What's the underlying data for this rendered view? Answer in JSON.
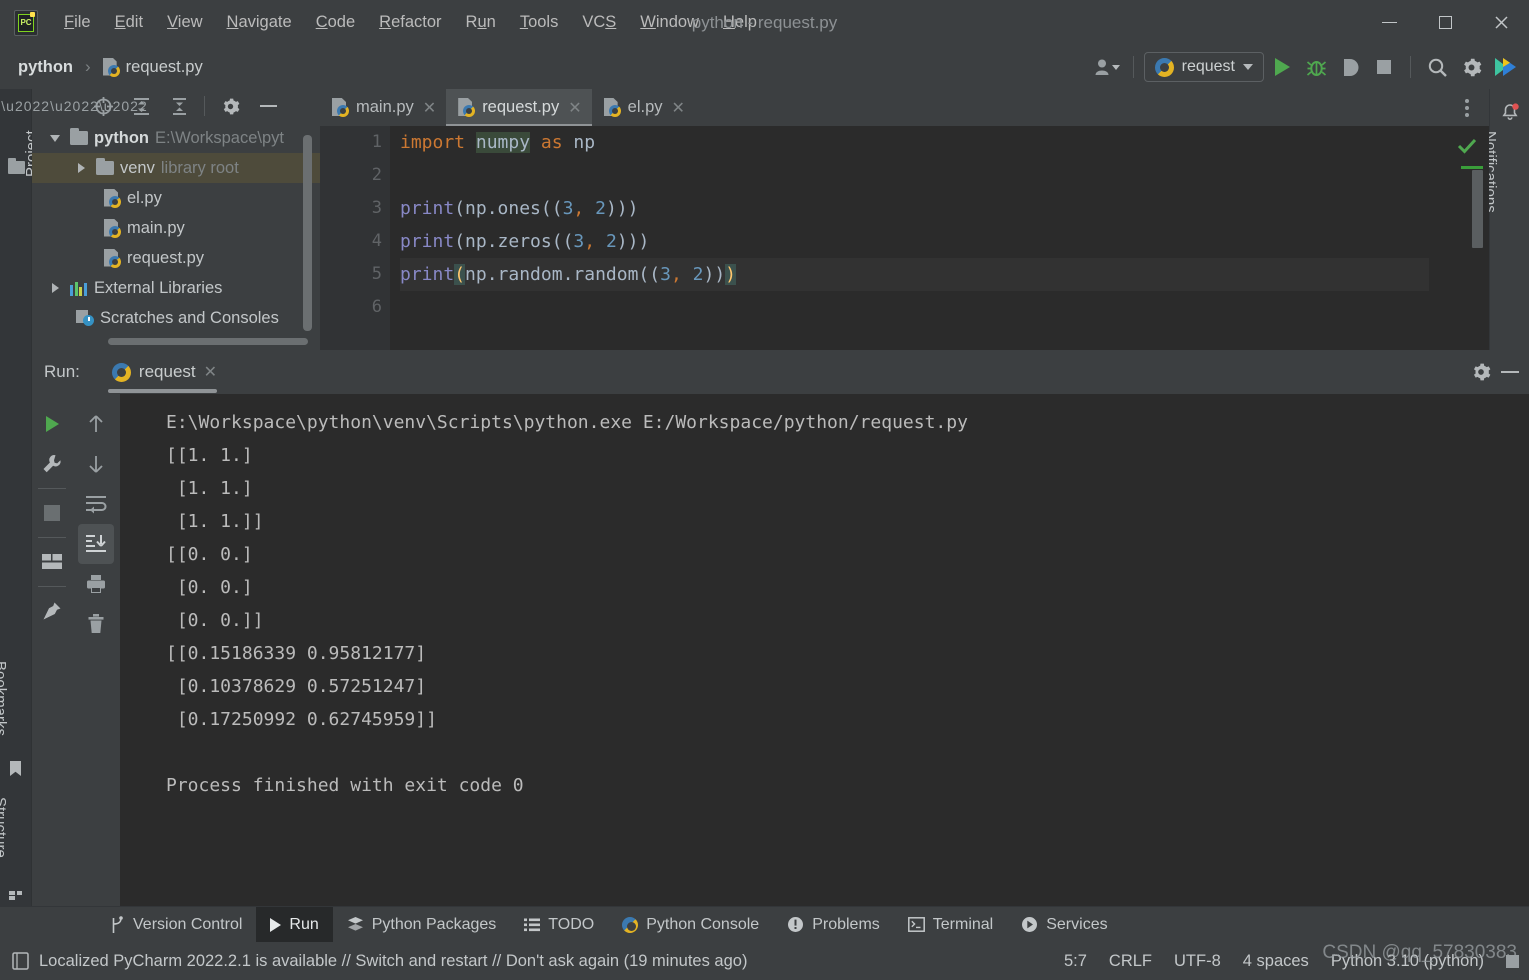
{
  "window": {
    "title": "python - request.py",
    "app_icon": "pycharm-logo-icon",
    "minimize": "—",
    "maximize": "□",
    "close": "✕"
  },
  "menubar": {
    "items": [
      {
        "label": "File",
        "mnemonic": "F"
      },
      {
        "label": "Edit",
        "mnemonic": "E"
      },
      {
        "label": "View",
        "mnemonic": "V"
      },
      {
        "label": "Navigate",
        "mnemonic": "N"
      },
      {
        "label": "Code",
        "mnemonic": "C"
      },
      {
        "label": "Refactor",
        "mnemonic": "R"
      },
      {
        "label": "Run",
        "mnemonic": "u"
      },
      {
        "label": "Tools",
        "mnemonic": "T"
      },
      {
        "label": "VCS",
        "mnemonic": "S"
      },
      {
        "label": "Window",
        "mnemonic": "W"
      },
      {
        "label": "Help",
        "mnemonic": "H"
      }
    ]
  },
  "navbar": {
    "breadcrumb_project": "python",
    "breadcrumb_separator": "›",
    "breadcrumb_file": "request.py",
    "run_config": "request",
    "icons": [
      "user-account-icon",
      "python-interpreter-icon",
      "run-icon",
      "debug-icon",
      "run-coverage-icon",
      "stop-icon",
      "search-everywhere-icon",
      "settings-gear-icon",
      "pycharm-brand-icon"
    ]
  },
  "left_toolbar": {
    "items": [
      {
        "label": "Project",
        "icon": "project-folder-icon"
      },
      {
        "label": "Bookmarks",
        "icon": "bookmark-icon"
      },
      {
        "label": "Structure",
        "icon": "structure-icon"
      }
    ]
  },
  "right_toolbar": {
    "items": [
      {
        "label": "Notifications",
        "icon": "bell-icon",
        "has_badge": true
      }
    ]
  },
  "project_panel": {
    "toolbar_icons": [
      "project-scope-icon",
      "locate-in-tree-icon",
      "expand-all-icon",
      "collapse-all-icon",
      "options-gear-icon",
      "hide-panel-icon"
    ],
    "tree": [
      {
        "label": "python",
        "hint": "E:\\Workspace\\pyt",
        "icon": "folder-icon",
        "arrow": "down",
        "indent": 0,
        "bold": true,
        "selected": false
      },
      {
        "label": "venv",
        "hint": "library root",
        "icon": "folder-icon",
        "arrow": "right",
        "indent": 1,
        "bold": false,
        "selected": true
      },
      {
        "label": "el.py",
        "hint": "",
        "icon": "python-file-icon",
        "arrow": "",
        "indent": 2,
        "bold": false,
        "selected": false
      },
      {
        "label": "main.py",
        "hint": "",
        "icon": "python-file-icon",
        "arrow": "",
        "indent": 2,
        "bold": false,
        "selected": false
      },
      {
        "label": "request.py",
        "hint": "",
        "icon": "python-file-icon",
        "arrow": "",
        "indent": 2,
        "bold": false,
        "selected": false
      },
      {
        "label": "External Libraries",
        "hint": "",
        "icon": "libraries-icon",
        "arrow": "right",
        "indent": 0,
        "bold": false,
        "selected": false
      },
      {
        "label": "Scratches and Consoles",
        "hint": "",
        "icon": "scratches-icon",
        "arrow": "",
        "indent": 1,
        "bold": false,
        "selected": false
      }
    ]
  },
  "editor": {
    "tabs": [
      {
        "label": "main.py",
        "icon": "python-file-icon",
        "active": false,
        "close": "✕"
      },
      {
        "label": "request.py",
        "icon": "python-file-icon",
        "active": true,
        "close": "✕"
      },
      {
        "label": "el.py",
        "icon": "python-file-icon",
        "active": false,
        "close": "✕"
      }
    ],
    "more_tabs_icon": "vertical-dots-icon",
    "inspection_status_icon": "green-check-icon",
    "line_numbers": [
      "1",
      "2",
      "3",
      "4",
      "5",
      "6"
    ],
    "lines": [
      {
        "n": "1",
        "text": "import numpy as np"
      },
      {
        "n": "2",
        "text": ""
      },
      {
        "n": "3",
        "text": "print(np.ones((3, 2)))"
      },
      {
        "n": "4",
        "text": "print(np.zeros((3, 2)))"
      },
      {
        "n": "5",
        "text": "print(np.random.random((3, 2)))"
      },
      {
        "n": "6",
        "text": ""
      }
    ],
    "tokens": {
      "l1_import": "import",
      "l1_numpy": "numpy",
      "l1_as": " as ",
      "l1_np": "np",
      "l3_fn": "print",
      "l3_open": "(",
      "l3_body": "np.ones((",
      "l3_a": "3",
      "l3_comma": ",",
      "l3_b": "2",
      "l3_close": ")))",
      "l4_fn": "print",
      "l4_open": "(",
      "l4_body": "np.zeros((",
      "l4_a": "3",
      "l4_comma": ",",
      "l4_b": "2",
      "l4_close": ")))",
      "l5_fn": "print",
      "l5_open": "(",
      "l5_body": "np.random.random((",
      "l5_a": "3",
      "l5_comma": ",",
      "l5_b": "2",
      "l5_mid": "))",
      "l5_close": ")"
    }
  },
  "run_panel": {
    "label": "Run:",
    "tab_label": "request",
    "tab_icon": "python-icon",
    "tab_close": "✕",
    "header_icons": [
      "settings-gear-icon",
      "hide-panel-icon"
    ],
    "left_tools": [
      "rerun-icon",
      "wrench-icon",
      "stop-icon",
      "layout-icon",
      "pin-tab-icon"
    ],
    "second_tools": [
      "up-arrow-icon",
      "down-arrow-icon",
      "soft-wrap-icon",
      "scroll-to-end-icon",
      "print-icon",
      "clear-all-icon"
    ],
    "console_lines": [
      "E:\\Workspace\\python\\venv\\Scripts\\python.exe E:/Workspace/python/request.py",
      "[[1. 1.]",
      " [1. 1.]",
      " [1. 1.]]",
      "[[0. 0.]",
      " [0. 0.]",
      " [0. 0.]]",
      "[[0.15186339 0.95812177]",
      " [0.10378629 0.57251247]",
      " [0.17250992 0.62745959]]",
      "",
      "Process finished with exit code 0"
    ]
  },
  "tool_windows": [
    {
      "label": "Version Control",
      "icon": "branch-icon",
      "active": false
    },
    {
      "label": "Run",
      "icon": "run-triangle-icon",
      "active": true
    },
    {
      "label": "Python Packages",
      "icon": "packages-icon",
      "active": false
    },
    {
      "label": "TODO",
      "icon": "todo-list-icon",
      "active": false
    },
    {
      "label": "Python Console",
      "icon": "python-icon",
      "active": false
    },
    {
      "label": "Problems",
      "icon": "problems-icon",
      "active": false
    },
    {
      "label": "Terminal",
      "icon": "terminal-icon",
      "active": false
    },
    {
      "label": "Services",
      "icon": "services-icon",
      "active": false
    }
  ],
  "statusbar": {
    "notification_icon": "ide-message-icon",
    "message": "Localized PyCharm 2022.2.1 is available // Switch and restart // Don't ask again (19 minutes ago)",
    "caret_position": "5:7",
    "line_separator": "CRLF",
    "encoding": "UTF-8",
    "indent": "4 spaces",
    "interpreter": "Python 3.10 (python)",
    "watermark": "CSDN @qq_57830383"
  },
  "colors": {
    "chrome_bg": "#3c3f41",
    "editor_bg": "#2b2b2b",
    "gutter_bg": "#313335",
    "selection_amber": "#4e4b3b",
    "accent_green": "#4fa84f",
    "keyword_orange": "#cc7832",
    "number_blue": "#6897bb",
    "function_violet": "#8888c6",
    "text_gray": "#a9b7c6"
  }
}
